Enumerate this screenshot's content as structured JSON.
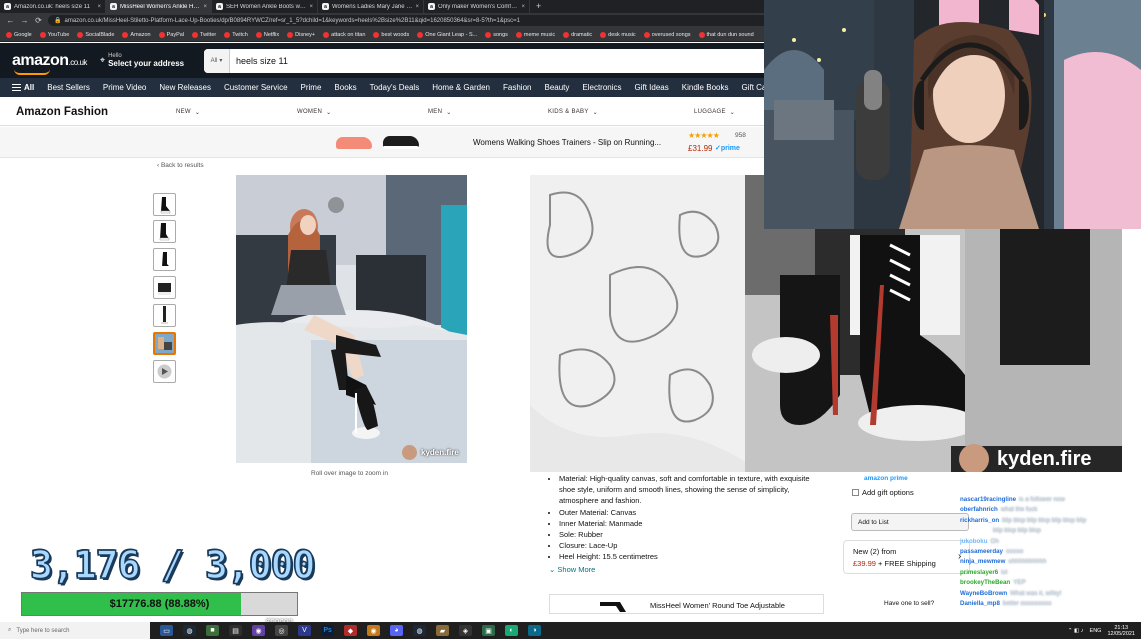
{
  "browser": {
    "tabs": [
      {
        "title": "Amazon.co.uk: heels size 11",
        "active": false
      },
      {
        "title": "MissHeel Women's Ankle High H",
        "active": true
      },
      {
        "title": "SEH Women Ankle Boots with H",
        "active": false
      },
      {
        "title": "Womens Ladies Mary Jane Comf",
        "active": false
      },
      {
        "title": "Only maker Women's Comfy Pu",
        "active": false
      }
    ],
    "tab_close": "×",
    "new_tab": "+",
    "url": "amazon.co.uk/MissHeel-Stiletto-Platform-Lace-Up-Booties/dp/B0894RYWCZ/ref=sr_1_5?dchild=1&keywords=heels%2Bsize%2B11&qid=1620850364&sr=8-5?th=1&psc=1",
    "bookmarks": [
      "Google",
      "YouTube",
      "SocialBlade",
      "Amazon",
      "PayPal",
      "Twitter",
      "Twitch",
      "Netflix",
      "Disney+",
      "attack on titan",
      "best woods",
      "One Giant Leap - S...",
      "songs",
      "meme music",
      "dramatic",
      "desk music",
      "overused songs",
      "that dun dun sound"
    ]
  },
  "amazon": {
    "logo": "amazon",
    "logo_tld": ".co.uk",
    "deliver_line1": "Hello",
    "deliver_line2": "Select your address",
    "search_category": "All",
    "search_value": "heels size 11",
    "nav_all": "All",
    "nav_links": [
      "Best Sellers",
      "Prime Video",
      "New Releases",
      "Customer Service",
      "Prime",
      "Books",
      "Today's Deals",
      "Home & Garden",
      "Fashion",
      "Beauty",
      "Electronics",
      "Gift Ideas",
      "Kindle Books",
      "Gift Ca"
    ],
    "store_title": "Amazon Fashion",
    "fashion_nav": [
      "NEW",
      "WOMEN",
      "MEN",
      "KIDS & BABY",
      "LUGGAGE"
    ],
    "ad": {
      "text": "Womens Walking Shoes Trainers - Slip on Running...",
      "rating_count": "958",
      "price": "£31.99",
      "prime": "✓prime",
      "rating": 4.5
    },
    "back_link": "‹ Back to results",
    "rollover_text": "Roll over image to zoom in",
    "watermark": "kyden.fire",
    "watermark_zoom": "kyden.fire",
    "bullets": [
      "Material: High-quality canvas, soft and comfortable in texture, with exquisite shoe style, uniform and smooth lines, showing the sense of simplicity, atmosphere and fashion.",
      "Outer Material: Canvas",
      "Inner Material: Manmade",
      "Sole: Rubber",
      "Closure: Lace-Up",
      "Heel Height: 15.5 centimetres"
    ],
    "show_more": "Show More",
    "related_product": "MissHeel Women' Round Toe Adjustable",
    "buybox": {
      "prime_label": "amazon prime",
      "gift_option": "Add gift options",
      "add_to_list": "Add to List",
      "new_offers": "New (2) from",
      "new_price": "£39.99",
      "shipping": "+ FREE Shipping",
      "have_one": "Have one to sell?"
    }
  },
  "overlay": {
    "counter": "3,176 / 3,000",
    "donation_label": "$17776.88 (88.88%)",
    "donation_fraction": 0.8888,
    "goal": "$20000"
  },
  "chat": [
    {
      "name": "nascar19racingline",
      "color": "#1e6bd6",
      "msg": "is a follower now"
    },
    {
      "name": "oberfahnrich",
      "color": "#1e6bd6",
      "msg": "what the fuck"
    },
    {
      "name": "rickharris_on",
      "color": "#1e6bd6",
      "msg": "blip blop blip blop blip blop blip"
    },
    {
      "name": "",
      "color": "#1e6bd6",
      "msg": "blip blop blip blop"
    },
    {
      "name": "jukoboku",
      "color": "#6fb6ff",
      "msg": "Oh"
    },
    {
      "name": "passameerday",
      "color": "#1e6bd6",
      "msg": "ooooo"
    },
    {
      "name": "ninja_mewmew",
      "color": "#1e6bd6",
      "msg": "ohhhhhhhhhh"
    },
    {
      "name": "primeslayer6",
      "color": "#2aa82a",
      "msg": "lol"
    },
    {
      "name": "brookeyTheBean",
      "color": "#2aa82a",
      "msg": "YEP"
    },
    {
      "name": "WayneBoBrown",
      "color": "#1e6bd6",
      "msg": "What was it, wifey!"
    },
    {
      "name": "Daniella_mp8",
      "color": "#1e6bd6",
      "msg": "better ooooooooo"
    }
  ],
  "taskbar": {
    "search_placeholder": "Type here to search",
    "tray_lang": "ENG",
    "time": "21:13",
    "date": "12/05/2021"
  },
  "colors": {
    "amazon_dark": "#131921",
    "amazon_nav": "#232f3e",
    "amazon_orange": "#ff9900",
    "price_red": "#b12704",
    "link_teal": "#007185",
    "progress_green": "#2fbf4a"
  }
}
